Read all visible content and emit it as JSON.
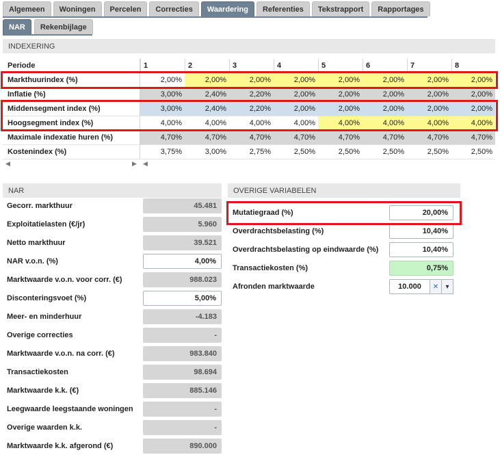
{
  "tabs": [
    "Algemeen",
    "Woningen",
    "Percelen",
    "Correcties",
    "Waardering",
    "Referenties",
    "Tekstrapport",
    "Rapportages"
  ],
  "active_tab": "Waardering",
  "subtabs": [
    "NAR",
    "Rekenbijlage"
  ],
  "active_subtab": "NAR",
  "indexering": {
    "title": "INDEXERING",
    "period_label": "Periode",
    "periods": [
      "1",
      "2",
      "3",
      "4",
      "5",
      "6",
      "7",
      "8"
    ],
    "rows": [
      {
        "label": "Markthuurindex (%)",
        "values": [
          "2,00%",
          "2,00%",
          "2,00%",
          "2,00%",
          "2,00%",
          "2,00%",
          "2,00%",
          "2,00%"
        ]
      },
      {
        "label": "Inflatie (%)",
        "values": [
          "3,00%",
          "2,40%",
          "2,20%",
          "2,00%",
          "2,00%",
          "2,00%",
          "2,00%",
          "2,00%"
        ]
      },
      {
        "label": "Middensegment index (%)",
        "values": [
          "3,00%",
          "2,40%",
          "2,20%",
          "2,00%",
          "2,00%",
          "2,00%",
          "2,00%",
          "2,00%"
        ]
      },
      {
        "label": "Hoogsegment index (%)",
        "values": [
          "4,00%",
          "4,00%",
          "4,00%",
          "4,00%",
          "4,00%",
          "4,00%",
          "4,00%",
          "4,00%"
        ]
      },
      {
        "label": "Maximale indexatie huren (%)",
        "values": [
          "4,70%",
          "4,70%",
          "4,70%",
          "4,70%",
          "4,70%",
          "4,70%",
          "4,70%",
          "4,70%"
        ]
      },
      {
        "label": "Kostenindex (%)",
        "values": [
          "3,75%",
          "3,00%",
          "2,75%",
          "2,50%",
          "2,50%",
          "2,50%",
          "2,50%",
          "2,50%"
        ]
      }
    ]
  },
  "nar": {
    "title": "NAR",
    "rows": [
      {
        "label": "Gecorr. markthuur",
        "value": "45.481"
      },
      {
        "label": "Exploitatielasten (€/jr)",
        "value": "5.960"
      },
      {
        "label": "Netto markthuur",
        "value": "39.521"
      },
      {
        "label": "NAR v.o.n. (%)",
        "value": "4,00%"
      },
      {
        "label": "Marktwaarde v.o.n. voor corr. (€)",
        "value": "988.023"
      },
      {
        "label": "Disconteringsvoet (%)",
        "value": "5,00%"
      },
      {
        "label": "Meer- en minderhuur",
        "value": "-4.183"
      },
      {
        "label": "Overige correcties",
        "value": "-"
      },
      {
        "label": "Marktwaarde v.o.n. na corr. (€)",
        "value": "983.840"
      },
      {
        "label": "Transactiekosten",
        "value": "98.694"
      },
      {
        "label": "Marktwaarde k.k. (€)",
        "value": "885.146"
      },
      {
        "label": "Leegwaarde leegstaande woningen",
        "value": "-"
      },
      {
        "label": "Overige waarden k.k.",
        "value": "-"
      },
      {
        "label": "Marktwaarde k.k. afgerond (€)",
        "value": "890.000"
      }
    ]
  },
  "overige": {
    "title": "OVERIGE VARIABELEN",
    "rows": [
      {
        "label": "Mutatiegraad (%)",
        "value": "20,00%"
      },
      {
        "label": "Overdrachtsbelasting (%)",
        "value": "10,40%"
      },
      {
        "label": "Overdrachtsbelasting op eindwaarde (%)",
        "value": "10,40%"
      },
      {
        "label": "Transactiekosten (%)",
        "value": "0,75%"
      },
      {
        "label": "Afronden marktwaarde",
        "value": "10.000"
      }
    ]
  },
  "icons": {
    "clear": "x-icon",
    "dropdown": "chevron-down-icon",
    "scroll_left": "triangle-left-icon",
    "scroll_right": "triangle-right-icon"
  },
  "colors": {
    "tab_active": "#6f8293",
    "highlight_yellow": "#fdf98e",
    "highlight_blue": "#cedeed",
    "readonly_gray": "#d6d6d6",
    "highlight_green": "#c8f5c8",
    "annotation_red": "#e0161b"
  }
}
